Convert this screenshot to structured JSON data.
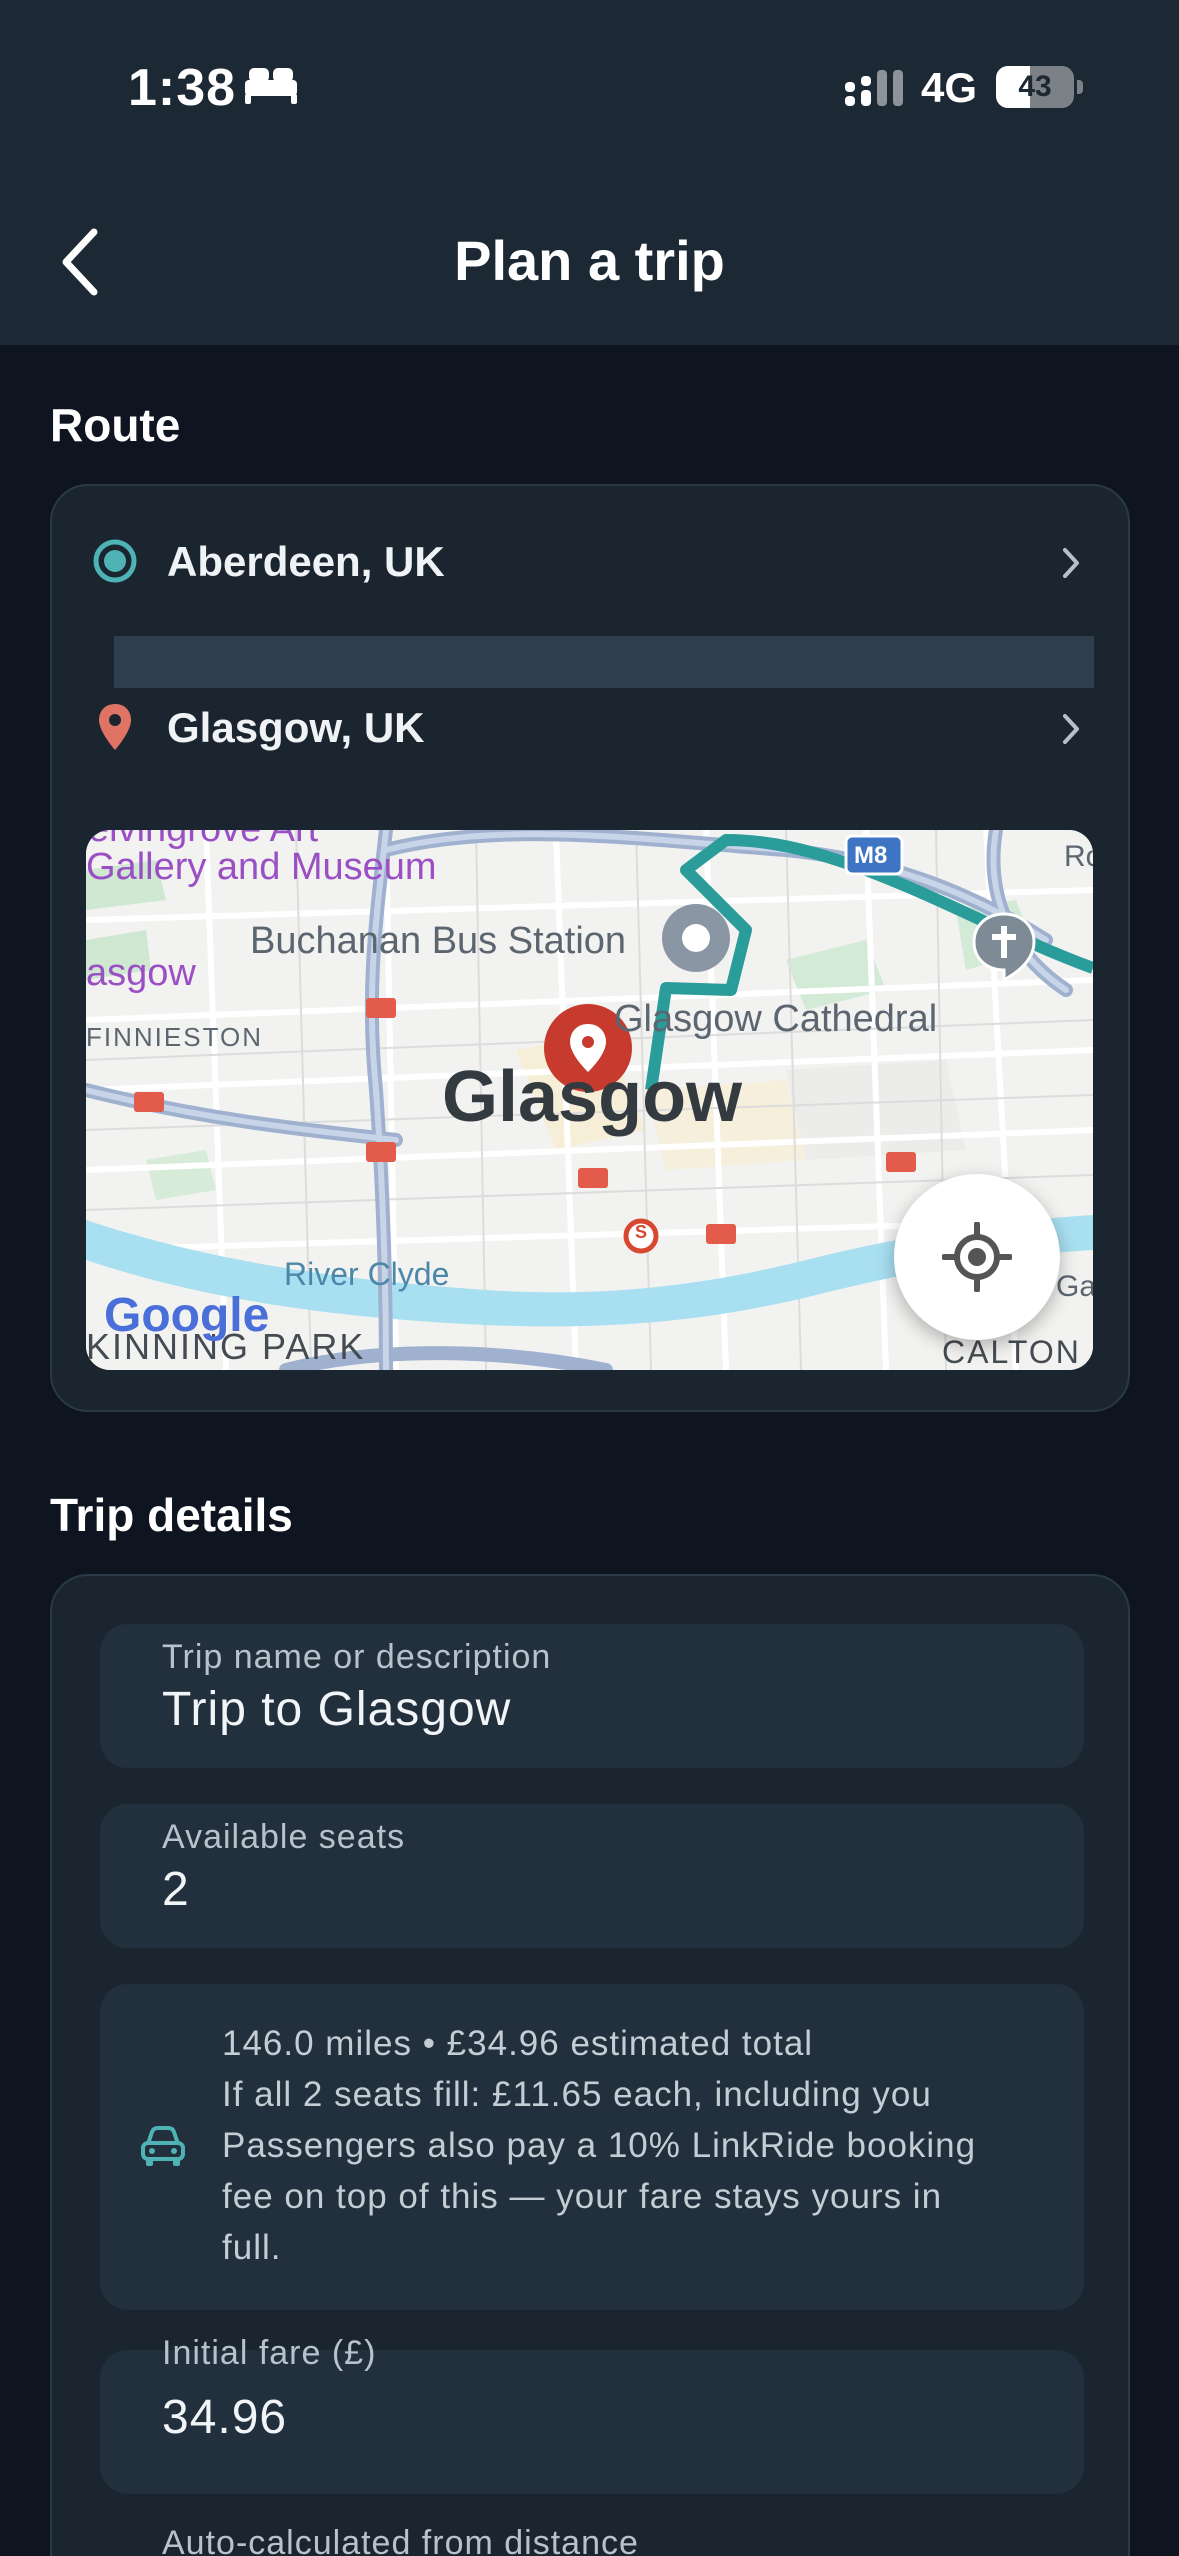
{
  "status_bar": {
    "time": "1:38",
    "network": "4G",
    "battery_level": 43,
    "battery_label": "43"
  },
  "header": {
    "title": "Plan a trip"
  },
  "route": {
    "section_title": "Route",
    "origin": "Aberdeen, UK",
    "destination": "Glasgow, UK",
    "map": {
      "labels": {
        "gallery_partial": "elvingrove Art",
        "gallery": "Gallery and Museum",
        "bus_station": "Buchanan Bus Station",
        "glasgow_partial": "asgow",
        "finnieston": "FINNIESTON",
        "cathedral": "Glasgow Cathedral",
        "city": "Glasgow",
        "river": "River Clyde",
        "kinning_park": "KINNING PARK",
        "calton": "CALTON",
        "motorway": "M8",
        "ro_partial": "Ro",
        "ga_partial": "Ga",
        "subway": "S",
        "logo": "Google"
      }
    }
  },
  "trip_details": {
    "section_title": "Trip details",
    "trip_name": {
      "label": "Trip name or description",
      "value": "Trip to Glasgow"
    },
    "seats": {
      "label": "Available seats",
      "value": "2"
    },
    "estimate": {
      "lines": [
        "146.0 miles • £34.96 estimated total",
        "If all 2 seats fill: £11.65 each, including you",
        "Passengers also pay a 10% LinkRide booking",
        "fee on top of this — your fare stays yours in",
        "full."
      ]
    },
    "fare": {
      "label": "Initial fare (£)",
      "value": "34.96",
      "helper": "Auto-calculated from distance"
    }
  }
}
